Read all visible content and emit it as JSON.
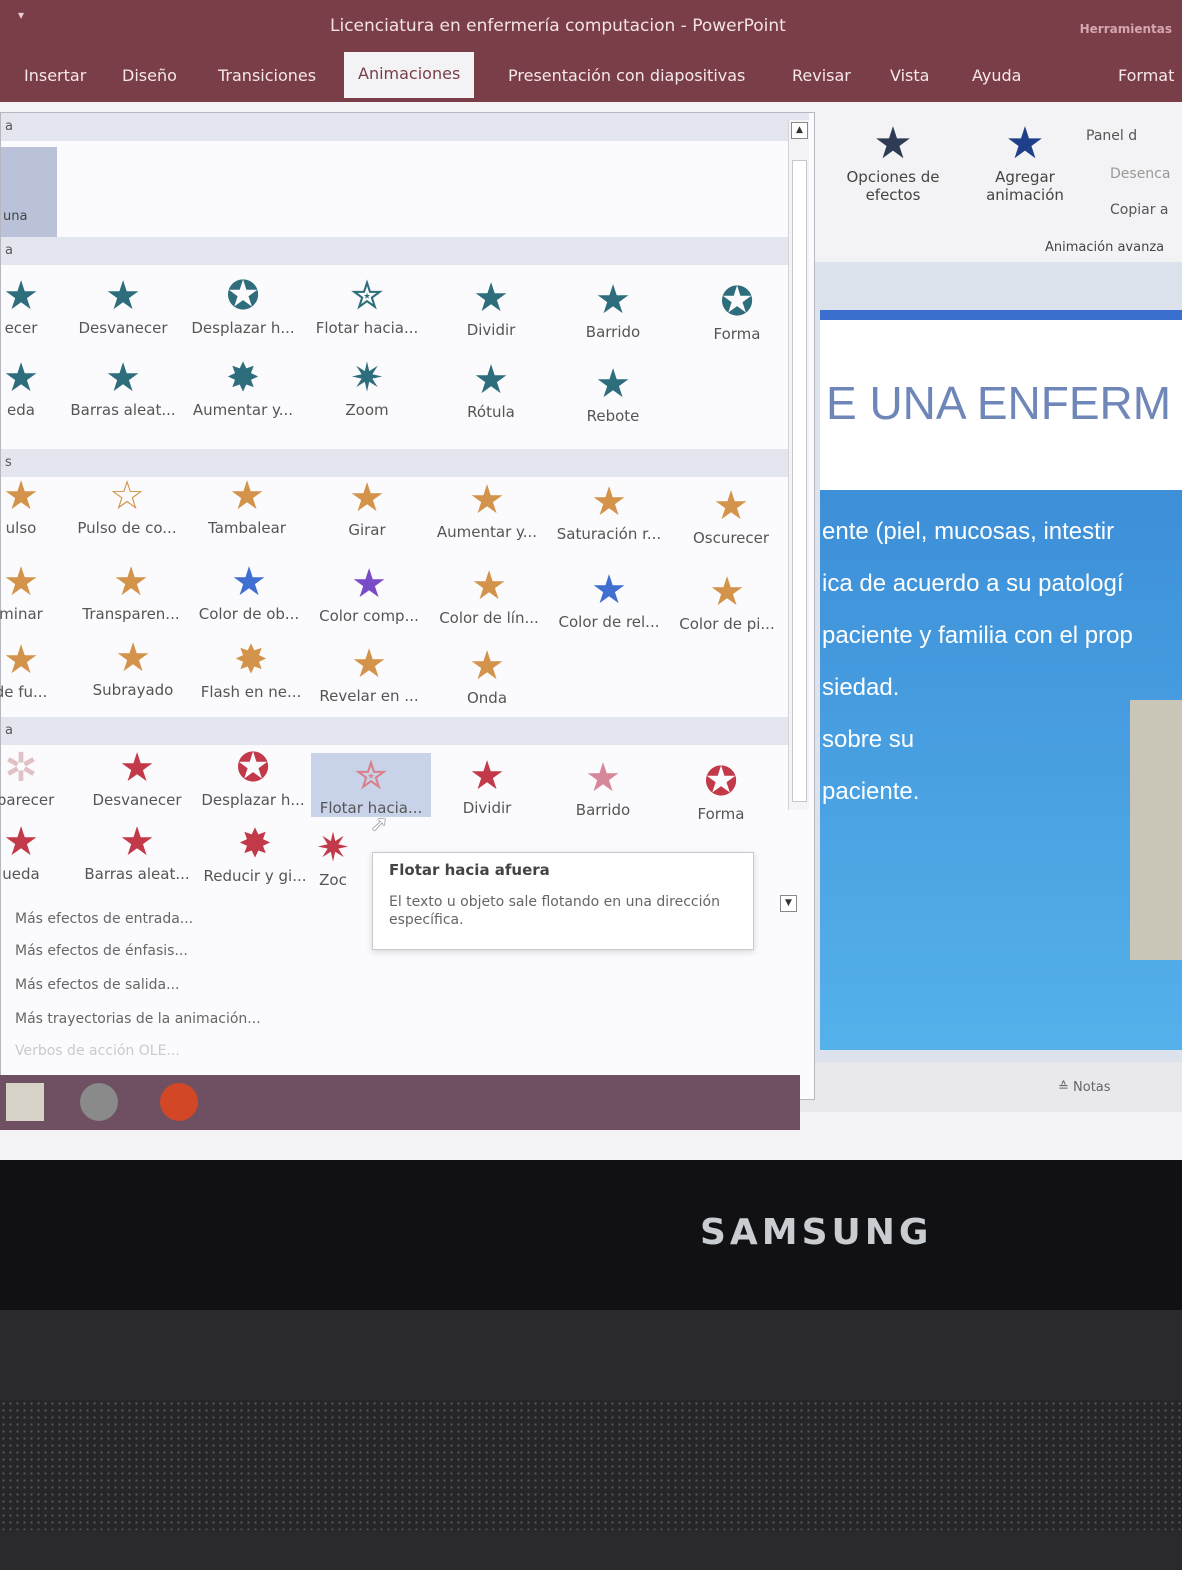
{
  "window": {
    "title": "Licenciatura en enfermería computacion  -  PowerPoint",
    "quick_access": "▾",
    "tools_label": "Herramientas"
  },
  "tabs": [
    {
      "label": "Insertar"
    },
    {
      "label": "Diseño"
    },
    {
      "label": "Transiciones"
    },
    {
      "label": "Animaciones"
    },
    {
      "label": "Presentación con diapositivas"
    },
    {
      "label": "Revisar"
    },
    {
      "label": "Vista"
    },
    {
      "label": "Ayuda"
    },
    {
      "label": "Format"
    }
  ],
  "ribbon": {
    "effect_options": "Opciones de efectos",
    "add_animation": "Agregar animación",
    "animation_pane": "Panel d",
    "trigger": "Desenca",
    "copy_animation": "Copiar a",
    "group_label": "Animación avanza"
  },
  "gallery": {
    "sections": {
      "none": "a",
      "entrance": "a",
      "emphasis": "s",
      "exit": "a"
    },
    "none_label": "una",
    "entrance": [
      {
        "label": "ecer",
        "icon": "★"
      },
      {
        "label": "Desvanecer",
        "icon": "★"
      },
      {
        "label": "Desplazar h...",
        "icon": "✪"
      },
      {
        "label": "Flotar hacia...",
        "icon": "✮"
      },
      {
        "label": "Dividir",
        "icon": "★"
      },
      {
        "label": "Barrido",
        "icon": "★"
      },
      {
        "label": "Forma",
        "icon": "✪"
      },
      {
        "label": "eda",
        "icon": "★"
      },
      {
        "label": "Barras aleat...",
        "icon": "★"
      },
      {
        "label": "Aumentar y...",
        "icon": "✸"
      },
      {
        "label": "Zoom",
        "icon": "✷"
      },
      {
        "label": "Rótula",
        "icon": "★"
      },
      {
        "label": "Rebote",
        "icon": "★"
      }
    ],
    "emphasis": [
      {
        "label": "ulso",
        "icon": "★"
      },
      {
        "label": "Pulso de co...",
        "icon": "☆"
      },
      {
        "label": "Tambalear",
        "icon": "★"
      },
      {
        "label": "Girar",
        "icon": "★"
      },
      {
        "label": "Aumentar y...",
        "icon": "★"
      },
      {
        "label": "Saturación r...",
        "icon": "★"
      },
      {
        "label": "Oscurecer",
        "icon": "★"
      },
      {
        "label": "minar",
        "icon": "★"
      },
      {
        "label": "Transparen...",
        "icon": "★"
      },
      {
        "label": "Color de ob...",
        "icon": "★"
      },
      {
        "label": "Color comp...",
        "icon": "★"
      },
      {
        "label": "Color de lín...",
        "icon": "★"
      },
      {
        "label": "Color de rel...",
        "icon": "★"
      },
      {
        "label": "Color de pi...",
        "icon": "★"
      },
      {
        "label": "de fu...",
        "icon": "★"
      },
      {
        "label": "Subrayado",
        "icon": "★"
      },
      {
        "label": "Flash en ne...",
        "icon": "✸"
      },
      {
        "label": "Revelar en ...",
        "icon": "★"
      },
      {
        "label": "Onda",
        "icon": "★"
      }
    ],
    "exit": [
      {
        "label": "aparecer",
        "icon": "✲"
      },
      {
        "label": "Desvanecer",
        "icon": "★"
      },
      {
        "label": "Desplazar h...",
        "icon": "✪"
      },
      {
        "label": "Flotar hacia...",
        "icon": "✮"
      },
      {
        "label": "Dividir",
        "icon": "★"
      },
      {
        "label": "Barrido",
        "icon": "★"
      },
      {
        "label": "Forma",
        "icon": "✪"
      },
      {
        "label": "ueda",
        "icon": "★"
      },
      {
        "label": "Barras aleat...",
        "icon": "★"
      },
      {
        "label": "Reducir y gi...",
        "icon": "✸"
      },
      {
        "label": "Zoc",
        "icon": "✷"
      }
    ],
    "more_links": [
      "Más efectos de entrada...",
      "Más efectos de énfasis...",
      "Más efectos de salida...",
      "Más trayectorias de la animación...",
      "Verbos de acción OLE..."
    ]
  },
  "tooltip": {
    "title": "Flotar hacia afuera",
    "text": "El texto u objeto sale flotando en una dirección específica."
  },
  "slide": {
    "heading": "E UNA ENFERM",
    "bullets": [
      "ente (piel, mucosas, intestir",
      "ica de acuerdo a su patologí",
      "paciente y familia con el prop",
      "siedad.",
      "sobre su",
      "paciente."
    ]
  },
  "status": {
    "notes": "≙ Notas"
  },
  "bezel": {
    "brand": "SAMSUNG"
  },
  "colors": {
    "titlebar": "#7a3e48",
    "entrance_icon": "#2e6d7c",
    "emphasis_icon": "#d4934a",
    "exit_icon": "#c23a4a"
  }
}
